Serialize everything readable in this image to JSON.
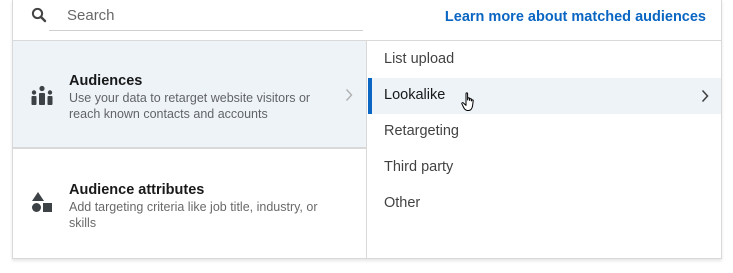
{
  "search": {
    "placeholder": "Search",
    "value": ""
  },
  "header": {
    "learn_more_link": "Learn more about matched audiences"
  },
  "categories": [
    {
      "title": "Audiences",
      "description": "Use your data to retarget website visitors or reach known contacts and accounts",
      "icon": "people-group-icon",
      "selected": true
    },
    {
      "title": "Audience attributes",
      "description": "Add targeting criteria like job title, industry, or skills",
      "icon": "shapes-icon",
      "selected": false
    }
  ],
  "options": [
    {
      "label": "List upload",
      "selected": false
    },
    {
      "label": "Lookalike",
      "selected": true
    },
    {
      "label": "Retargeting",
      "selected": false
    },
    {
      "label": "Third party",
      "selected": false
    },
    {
      "label": "Other",
      "selected": false
    }
  ],
  "colors": {
    "accent": "#0a66c2",
    "selected_background": "#eef3f8",
    "border": "#d9d9d9"
  }
}
